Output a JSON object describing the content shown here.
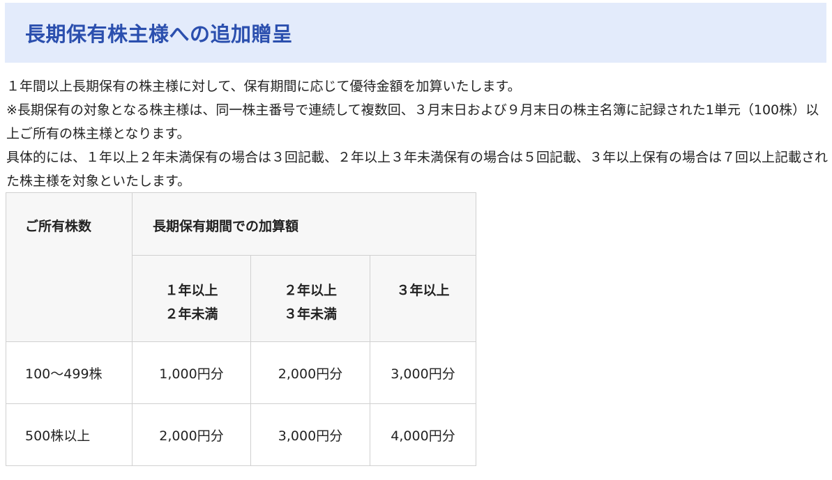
{
  "section": {
    "title": "長期保有株主様への追加贈呈"
  },
  "intro": {
    "paragraph1": "１年間以上長期保有の株主様に対して、保有期間に応じて優待金額を加算いたします。",
    "paragraph2": "※長期保有の対象となる株主様は、同一株主番号で連続して複数回、３月末日および９月末日の株主名簿に記録された1単元（100株）以上ご所有の株主様となります。",
    "paragraph3": "具体的には、１年以上２年未満保有の場合は３回記載、２年以上３年未満保有の場合は５回記載、３年以上保有の場合は７回以上記載された株主様を対象といたします。"
  },
  "table": {
    "header_shares": "ご所有株数",
    "header_bonus": "長期保有期間での加算額",
    "periods": [
      {
        "line1": "１年以上",
        "line2": "２年未満"
      },
      {
        "line1": "２年以上",
        "line2": "３年未満"
      },
      {
        "line1": "３年以上",
        "line2": ""
      }
    ],
    "rows": [
      {
        "shares": "100～499株",
        "amounts": [
          "1,000円分",
          "2,000円分",
          "3,000円分"
        ]
      },
      {
        "shares": "500株以上",
        "amounts": [
          "2,000円分",
          "3,000円分",
          "4,000円分"
        ]
      }
    ]
  }
}
